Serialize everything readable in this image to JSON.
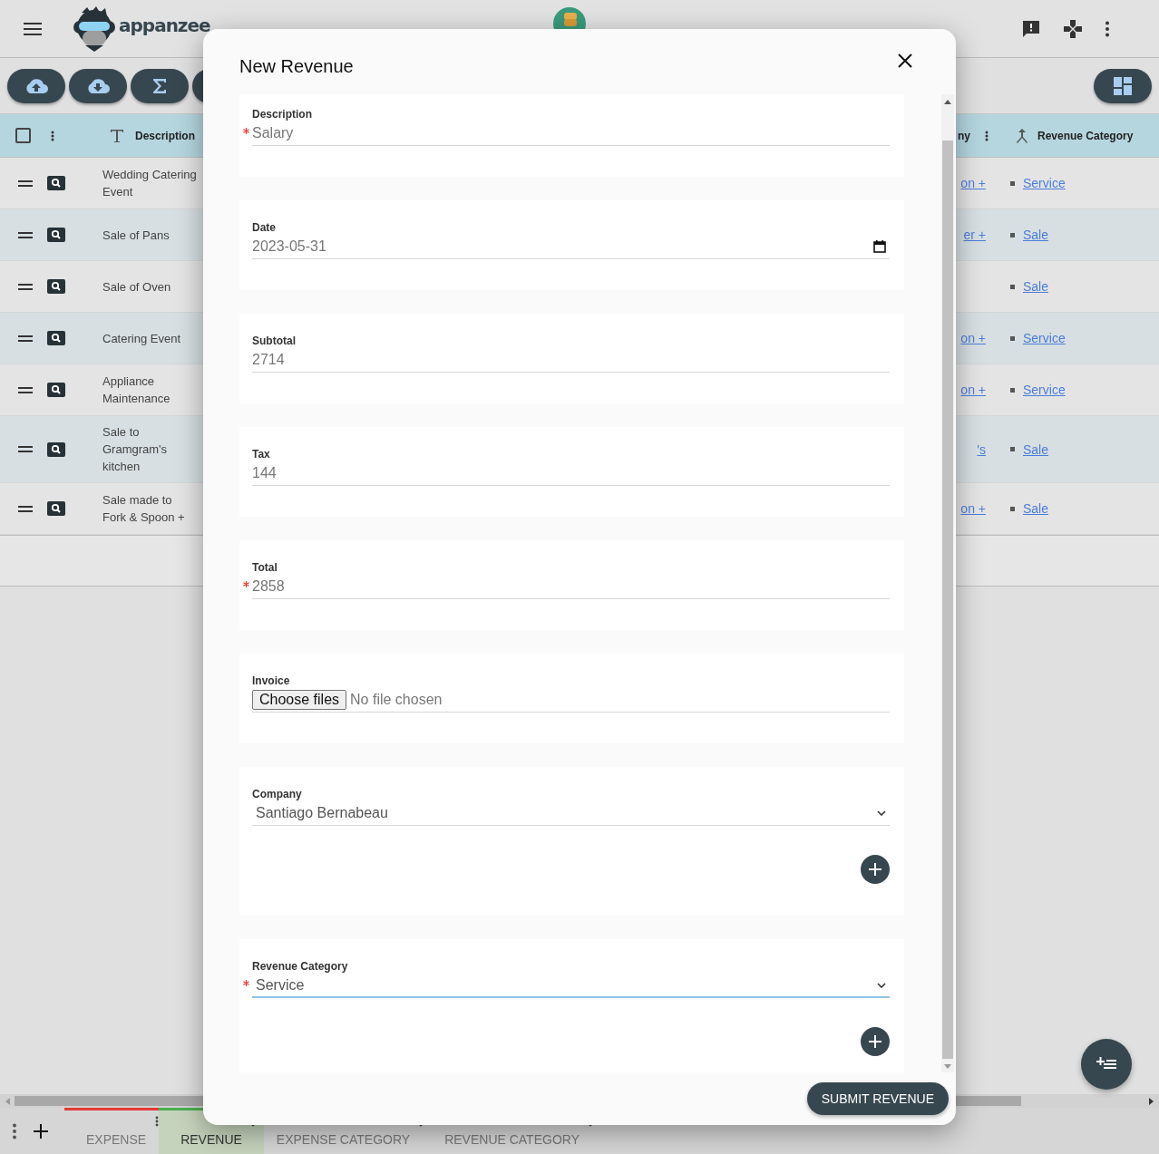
{
  "app_bar": {
    "logo_text": "appanzee"
  },
  "table": {
    "select_all_checked": false,
    "columns": [
      {
        "label": "Description"
      },
      {
        "label": "ny"
      },
      {
        "label": "Revenue Category"
      }
    ],
    "rows": [
      {
        "description": "Wedding Catering Event",
        "company": "on +",
        "category": "Service"
      },
      {
        "description": "Sale of Pans",
        "company": "er +",
        "category": "Sale"
      },
      {
        "description": "Sale of Oven",
        "category": "Sale"
      },
      {
        "description": "Catering Event",
        "company": "on +",
        "category": "Service"
      },
      {
        "description": "Appliance Maintenance",
        "company": "on +",
        "category": "Service"
      },
      {
        "description": "Sale to Gramgram's kitchen",
        "company": "'s",
        "category": "Sale"
      },
      {
        "description": "Sale made to Fork & Spoon +",
        "company": "on +",
        "category": "Sale"
      }
    ]
  },
  "modal": {
    "title": "New Revenue",
    "fields": [
      {
        "kind": "text",
        "label": "Description",
        "value": "Salary",
        "required": true
      },
      {
        "kind": "date",
        "label": "Date",
        "value": "2023-05-31",
        "required": false
      },
      {
        "kind": "text",
        "label": "Subtotal",
        "value": "2714",
        "required": false
      },
      {
        "kind": "text",
        "label": "Tax",
        "value": "144",
        "required": false
      },
      {
        "kind": "text",
        "label": "Total",
        "value": "2858",
        "required": true
      },
      {
        "kind": "file",
        "label": "Invoice",
        "button": "Choose files",
        "value": "No file chosen",
        "required": false
      },
      {
        "kind": "select",
        "label": "Company",
        "value": "Santiago Bernabeau",
        "required": false,
        "focused": false
      },
      {
        "kind": "select",
        "label": "Revenue Category",
        "value": "Service",
        "required": true,
        "focused": true
      }
    ],
    "submit": "SUBMIT REVENUE"
  },
  "tabs": [
    {
      "label": "EXPENSE",
      "selected": false,
      "color": "#e53935"
    },
    {
      "label": "REVENUE",
      "selected": true,
      "color": "#4caf50"
    },
    {
      "label": "EXPENSE CATEGORY",
      "selected": false
    },
    {
      "label": "REVENUE CATEGORY",
      "selected": false
    }
  ]
}
